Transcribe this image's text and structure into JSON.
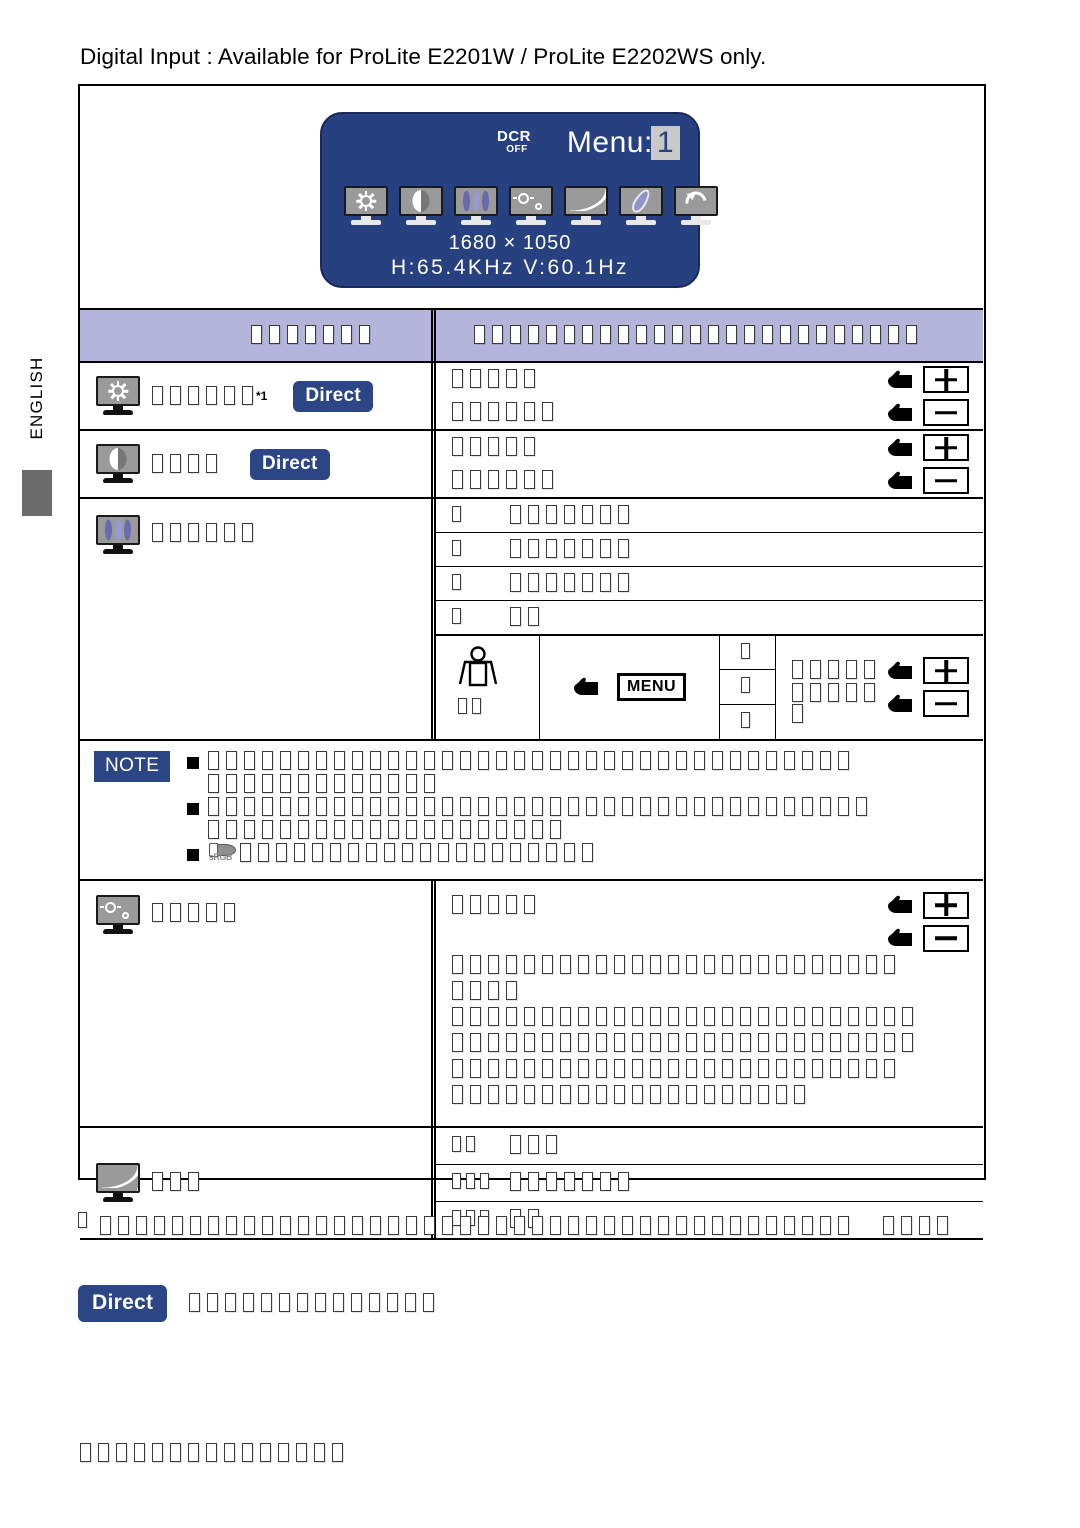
{
  "heading": "Digital Input : Available for ProLite E2201W / ProLite E2202WS only.",
  "language_tab": "ENGLISH",
  "osd": {
    "dcr_label": "DCR",
    "dcr_state": "OFF",
    "menu_label": "Menu:",
    "menu_page": "1",
    "resolution": "1680 × 1050",
    "frequency": "H:65.4KHz  V:60.1Hz",
    "icons": [
      "brightness-monitor-icon",
      "contrast-monitor-icon",
      "color-temp-monitor-icon",
      "istyle-monitor-icon",
      "gamma-monitor-icon",
      "eco-leaf-monitor-icon",
      "recall-monitor-icon"
    ]
  },
  "table": {
    "header": {
      "col1": "□□□□□□□",
      "col2": "□□□□□□□□□□□□□□□□□□□□□□□□□"
    },
    "rows": [
      {
        "id": "brightness",
        "icon": "brightness-monitor-icon",
        "label_boxes": 6,
        "footnote_mark": "*1",
        "direct_label": "Direct",
        "controls": [
          {
            "boxes": 5,
            "hand": "hand-pointer-icon",
            "key": "+"
          },
          {
            "boxes": 6,
            "hand": "hand-pointer-icon",
            "key": "−"
          }
        ]
      },
      {
        "id": "contrast",
        "icon": "contrast-monitor-icon",
        "label_boxes": 4,
        "footnote_mark": "",
        "direct_label": "Direct",
        "controls": [
          {
            "boxes": 5,
            "hand": "hand-pointer-icon",
            "key": "+"
          },
          {
            "boxes": 6,
            "hand": "hand-pointer-icon",
            "key": "−"
          }
        ]
      },
      {
        "id": "color-temp",
        "icon": "color-temp-monitor-icon",
        "label_boxes": 6,
        "options": [
          {
            "key_boxes": 1,
            "val_boxes": 7
          },
          {
            "key_boxes": 1,
            "val_boxes": 7
          },
          {
            "key_boxes": 1,
            "val_boxes": 7
          },
          {
            "key_boxes": 1,
            "val_boxes": 2
          }
        ],
        "user_color": {
          "icon": "person-icon",
          "label_boxes": 2,
          "menu_key": "MENU",
          "hand": "hand-pointer-icon",
          "channels": [
            {
              "box": 1
            },
            {
              "box": 1
            },
            {
              "box": 1
            }
          ],
          "controls": [
            {
              "boxes": 5,
              "hand": "hand-pointer-icon",
              "key": "+"
            },
            {
              "boxes": 6,
              "hand": "hand-pointer-icon",
              "key": "−"
            }
          ]
        }
      }
    ],
    "note": {
      "badge": "NOTE",
      "lines": [
        {
          "bullet": true,
          "boxes": 36
        },
        {
          "bullet": false,
          "boxes": 13
        },
        {
          "bullet": true,
          "boxes": 37
        },
        {
          "bullet": false,
          "boxes": 20
        },
        {
          "bullet": true,
          "boxes": 20,
          "icon": "srgb-icon"
        }
      ]
    },
    "istyle": {
      "id": "istyle",
      "icon": "istyle-monitor-icon",
      "label_boxes": 5,
      "controls": [
        {
          "boxes": 5,
          "hand": "hand-pointer-icon",
          "key": "+"
        },
        {
          "boxes": 0,
          "hand": "hand-pointer-icon",
          "key": "−"
        }
      ],
      "paragraph_lines": [
        25,
        4,
        26,
        26,
        25,
        20
      ]
    },
    "gamma": {
      "id": "gamma",
      "icon": "gamma-monitor-icon",
      "label_boxes": 3,
      "options": [
        {
          "key_boxes": 2,
          "val_boxes": 3
        },
        {
          "key_boxes": 3,
          "val_boxes": 7
        },
        {
          "key_boxes": 3,
          "val_boxes": 2
        }
      ]
    }
  },
  "footnote": {
    "mark_boxes": 1,
    "line1_boxes": 42,
    "line2_boxes": 4
  },
  "legend": {
    "badge": "Direct",
    "text_boxes": 14
  },
  "bottom_note": {
    "boxes": 15
  }
}
